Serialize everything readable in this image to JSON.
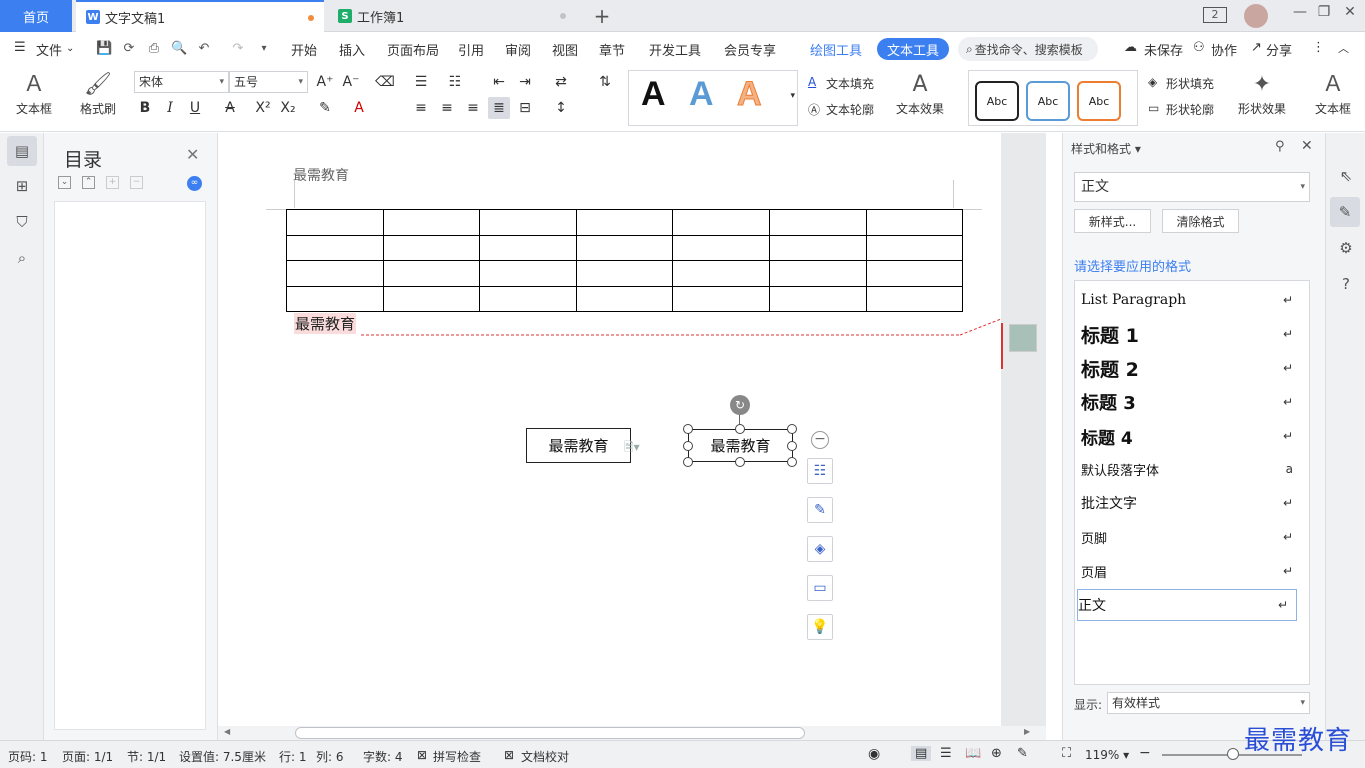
{
  "tabs": {
    "home": "首页",
    "doc_tab": "文字文稿1",
    "sheet_tab": "工作簿1",
    "doc_icon": "W",
    "sheet_icon": "S",
    "window_count": "2"
  },
  "menu": {
    "file": "文件",
    "items": [
      "开始",
      "插入",
      "页面布局",
      "引用",
      "审阅",
      "视图",
      "章节",
      "开发工具",
      "会员专享",
      "绘图工具"
    ],
    "active_pill": "文本工具",
    "search": "查找命令、搜索模板",
    "unsaved": "未保存",
    "collab": "协作",
    "share": "分享"
  },
  "ribbon": {
    "textbox": "文本框",
    "format_painter": "格式刷",
    "font_name": "宋体",
    "font_size": "五号",
    "text_fill": "文本填充",
    "text_outline": "文本轮廓",
    "text_effect": "文本效果",
    "shape_fill": "形状填充",
    "shape_outline": "形状轮廓",
    "shape_effect": "形状效果",
    "abc1": "Abc",
    "abc2": "Abc",
    "abc3": "Abc",
    "textbox_right": "文本框"
  },
  "toc": {
    "title": "目录"
  },
  "document": {
    "header": "最需教育",
    "body_text": "最需教育",
    "textbox1": "最需教育",
    "textbox2": "最需教育",
    "table_rows": 4,
    "table_cols": 7
  },
  "styles_panel": {
    "title": "样式和格式",
    "current_style": "正文",
    "new_style": "新样式...",
    "clear_format": "清除格式",
    "choose_label": "请选择要应用的格式",
    "items": [
      "List Paragraph",
      "标题 1",
      "标题 2",
      "标题 3",
      "标题 4",
      "默认段落字体",
      "批注文字",
      "页脚",
      "页眉",
      "正文"
    ],
    "show_label": "显示:",
    "show_value": "有效样式"
  },
  "status": {
    "page_num": "页码: 1",
    "pages": "页面: 1/1",
    "section": "节: 1/1",
    "setting": "设置值: 7.5厘米",
    "row": "行: 1",
    "col": "列: 6",
    "words": "字数: 4",
    "spell": "拼写检查",
    "proof": "文档校对",
    "zoom": "119%"
  },
  "watermark": "最需教育",
  "colors": {
    "accent": "#3c7ff0",
    "doc_dot": "#f08c3c",
    "sheet_icon": "#1fae6a"
  }
}
